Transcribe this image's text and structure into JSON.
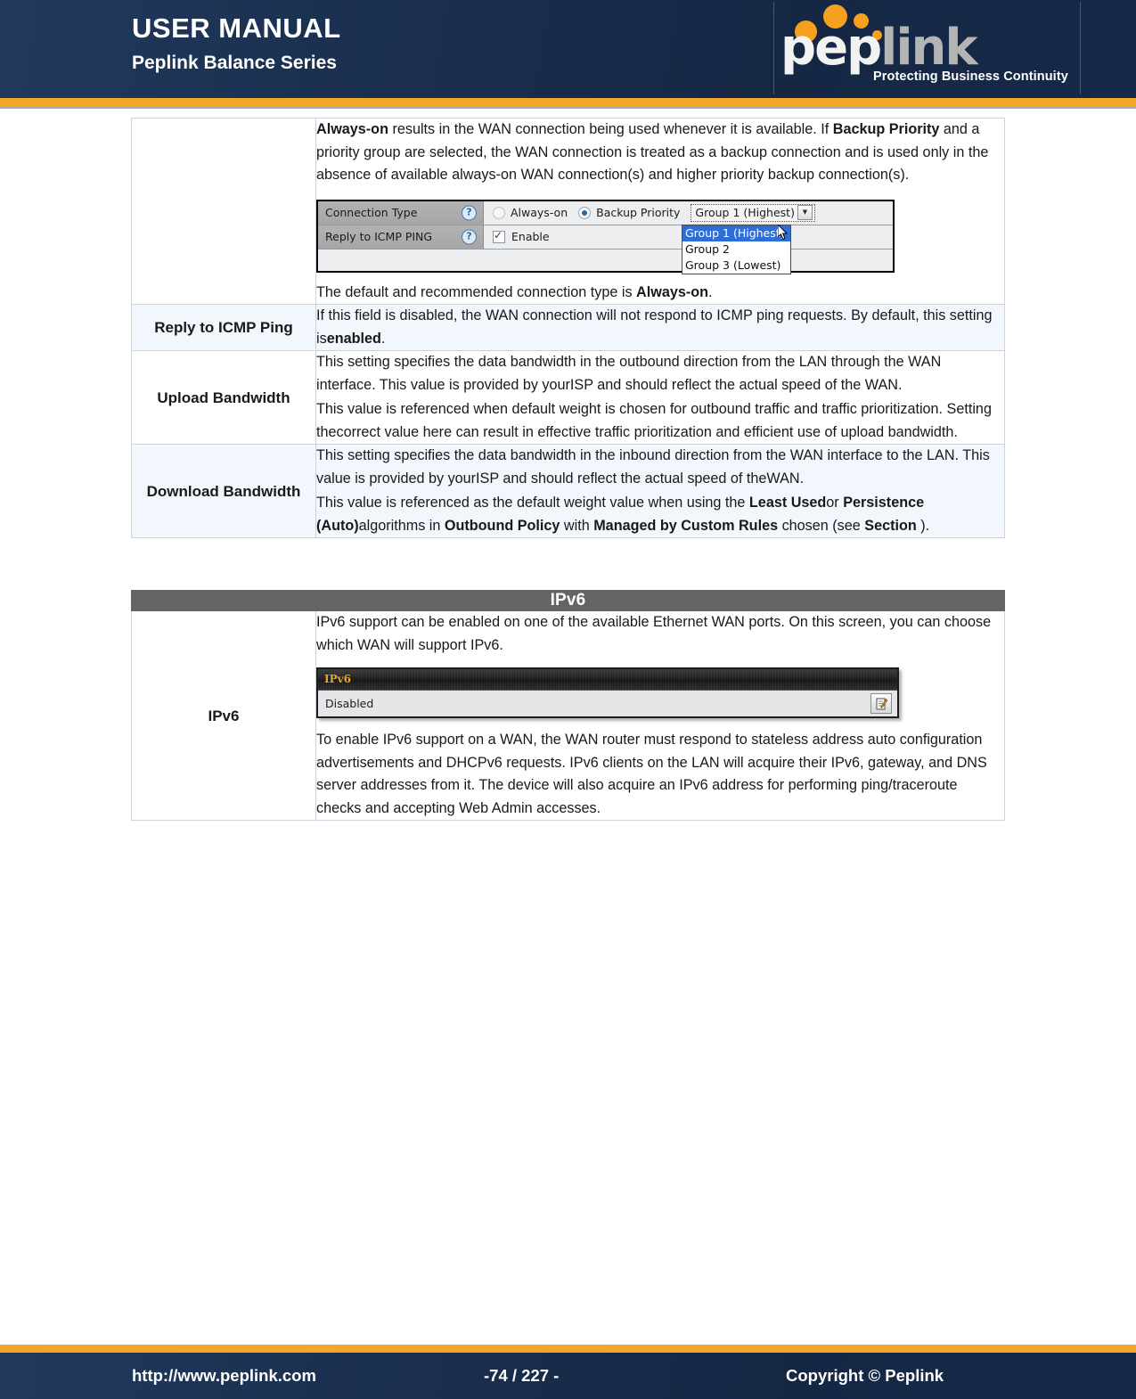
{
  "header": {
    "title": "USER MANUAL",
    "subtitle": "Peplink Balance Series",
    "logo": {
      "word_part1": "pep",
      "word_part2": "link",
      "tagline": "Protecting Business Continuity"
    }
  },
  "settings_table": {
    "rows": [
      {
        "label": "",
        "paragraphs": [
          "<b>Always-on</b> results in the WAN connection being used whenever it is available. If <b>Backup Priority</b> and a priority group are selected, the WAN connection is treated as a backup connection and is used only in the absence of available always-on WAN connection(s) and higher priority backup connection(s).",
          "The default and recommended connection type is <b>Always-on</b>."
        ]
      },
      {
        "label": "Reply to ICMP Ping",
        "paragraphs": [
          "If this field is disabled, the WAN connection will not respond to ICMP ping requests. By default, this setting is<b>enabled</b>."
        ]
      },
      {
        "label": "Upload Bandwidth",
        "paragraphs": [
          "This setting specifies the data bandwidth in the outbound direction from the LAN through the WAN interface. This value is provided by yourISP and should reflect the actual speed of the WAN.",
          "This value is referenced when default weight is chosen for outbound traffic and traffic prioritization. Setting thecorrect value here can result in effective traffic prioritization and efficient use of upload bandwidth."
        ]
      },
      {
        "label": "Download Bandwidth",
        "paragraphs": [
          "This setting specifies the data bandwidth in the inbound direction from the WAN interface to the LAN. This value is provided by yourISP and should reflect the actual speed of theWAN.",
          "This value is referenced as the default weight value when using the <b>Least Used</b>or <b>Persistence (Auto)</b>algorithms in <b>Outbound Policy</b> with <b>Managed by Custom Rules</b> chosen (see <b>Section</b> )."
        ]
      }
    ]
  },
  "connection_widget": {
    "rows": [
      {
        "label": "Connection Type",
        "help": "?"
      },
      {
        "label": "Reply to ICMP PING",
        "help": "?"
      }
    ],
    "radio_always_on": "Always-on",
    "radio_backup_priority": "Backup Priority",
    "radio_selected": "Backup Priority",
    "select_value": "Group 1 (Highest)",
    "select_options": [
      "Group 1 (Highest)",
      "Group 2",
      "Group 3 (Lowest)"
    ],
    "selected_option": "Group 1 (Highest)",
    "enable_label": "Enable",
    "enable_checked": true
  },
  "ipv6_table": {
    "header": "IPv6",
    "row_label": "IPv6",
    "paragraph_before": "IPv6 support can be enabled on one of the available Ethernet WAN ports. On this screen, you can choose which WAN will support IPv6.",
    "paragraph_after": "To enable IPv6 support on a WAN, the WAN router must respond to stateless address auto configuration advertisements and DHCPv6 requests. IPv6 clients on the LAN will acquire their IPv6, gateway, and DNS server addresses from it. The device will also acquire an IPv6 address for performing ping/traceroute checks and accepting Web Admin accesses."
  },
  "ipv6_widget": {
    "title": "IPv6",
    "status": "Disabled",
    "edit_icon": "edit-icon"
  },
  "footer": {
    "url": "http://www.peplink.com",
    "page": "-74 / 227 -",
    "copyright": "Copyright ©  Peplink"
  },
  "colors": {
    "header_navy": "#1a2f4f",
    "accent_orange": "#f3a62a",
    "table_alt_row": "#f2f6fd",
    "ipv6_header_gray": "#646464",
    "ipv6_title_amber": "#e9a626",
    "dropdown_select_blue": "#2e6ed6"
  }
}
